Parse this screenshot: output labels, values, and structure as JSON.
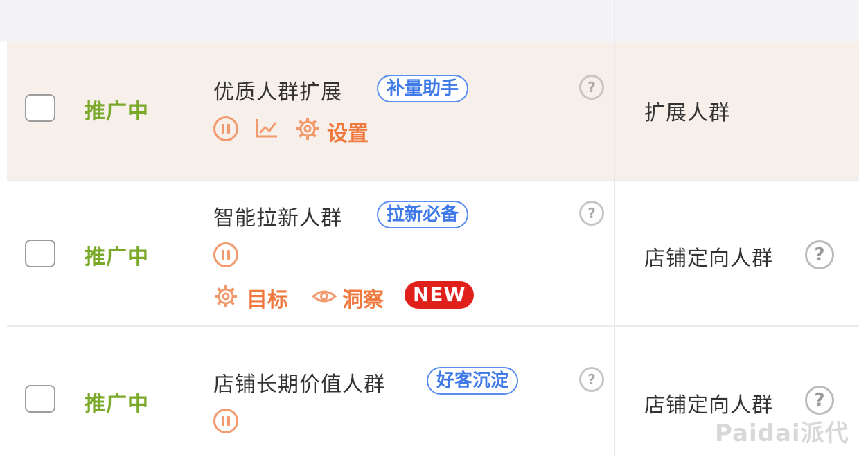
{
  "rows": [
    {
      "status": "推广中",
      "name": "优质人群扩展",
      "tag": "补量助手",
      "actions": {
        "settings": "设置"
      },
      "crowd_type": "扩展人群"
    },
    {
      "status": "推广中",
      "name": "智能拉新人群",
      "tag": "拉新必备",
      "actions": {
        "target": "目标",
        "insight": "洞察",
        "badge": "NEW"
      },
      "crowd_type": "店铺定向人群"
    },
    {
      "status": "推广中",
      "name": "店铺长期价值人群",
      "tag": "好客沉淀",
      "actions": {},
      "crowd_type": "店铺定向人群"
    }
  ],
  "help_glyph": "?",
  "watermark": "Paidai派代",
  "colors": {
    "status_green": "#7aa829",
    "action_orange": "#f0793f",
    "tag_blue": "#3f7ae8",
    "new_red": "#e0211b",
    "row_highlight": "#f7efe9"
  }
}
